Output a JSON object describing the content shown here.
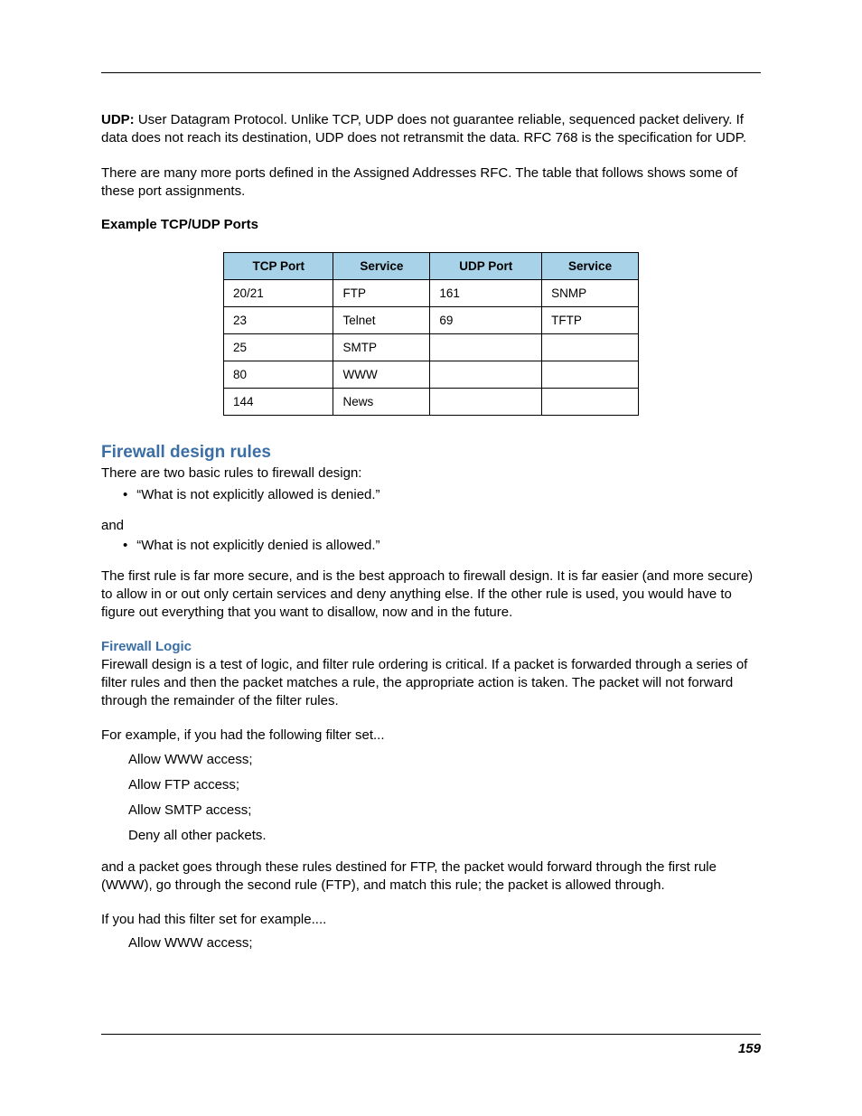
{
  "udp": {
    "label": "UDP:",
    "text": " User Datagram Protocol. Unlike TCP, UDP does not guarantee reliable, sequenced packet delivery. If data does not reach its destination, UDP does not retransmit the data. RFC 768 is the specification for UDP."
  },
  "more_ports": "There are many more ports defined in the Assigned Addresses RFC. The table that follows shows some of these port assignments.",
  "example_heading": "Example TCP/UDP Ports",
  "table": {
    "headers": [
      "TCP Port",
      "Service",
      "UDP Port",
      "Service"
    ],
    "rows": [
      [
        "20/21",
        "FTP",
        "161",
        "SNMP"
      ],
      [
        "23",
        "Telnet",
        "69",
        "TFTP"
      ],
      [
        "25",
        "SMTP",
        "",
        ""
      ],
      [
        "80",
        "WWW",
        "",
        ""
      ],
      [
        "144",
        "News",
        "",
        ""
      ]
    ]
  },
  "fw_rules_heading": "Firewall design rules",
  "fw_rules_intro": "There are two basic rules to firewall design:",
  "rule1": "“What is not explicitly allowed is denied.”",
  "and": "and",
  "rule2": "“What is not explicitly denied is allowed.”",
  "fw_rules_para": "The first rule is far more secure, and is the best approach to firewall design. It is far easier (and more secure) to allow in or out only certain services and deny anything else. If the other rule is used, you would have to figure out everything that you want to disallow, now and in the future.",
  "fw_logic_heading": "Firewall Logic",
  "fw_logic_para1": "Firewall design is a test of logic, and filter rule ordering is critical. If a packet is forwarded through a series of filter rules and then the packet matches a rule, the appropriate action is taken. The packet will not forward through the remainder of the filter rules.",
  "fw_logic_example_intro": "For example, if you had the following filter set...",
  "filter_set1": [
    "Allow WWW access;",
    "Allow FTP access;",
    "Allow SMTP access;",
    "Deny all other packets."
  ],
  "fw_logic_para2": "and a packet goes through these rules destined for FTP, the packet would forward through the first rule (WWW), go through the second rule (FTP), and match this rule; the packet is allowed through.",
  "fw_logic_example2_intro": "If you had this filter set for example....",
  "filter_set2": [
    "Allow WWW access;"
  ],
  "page_number": "159"
}
